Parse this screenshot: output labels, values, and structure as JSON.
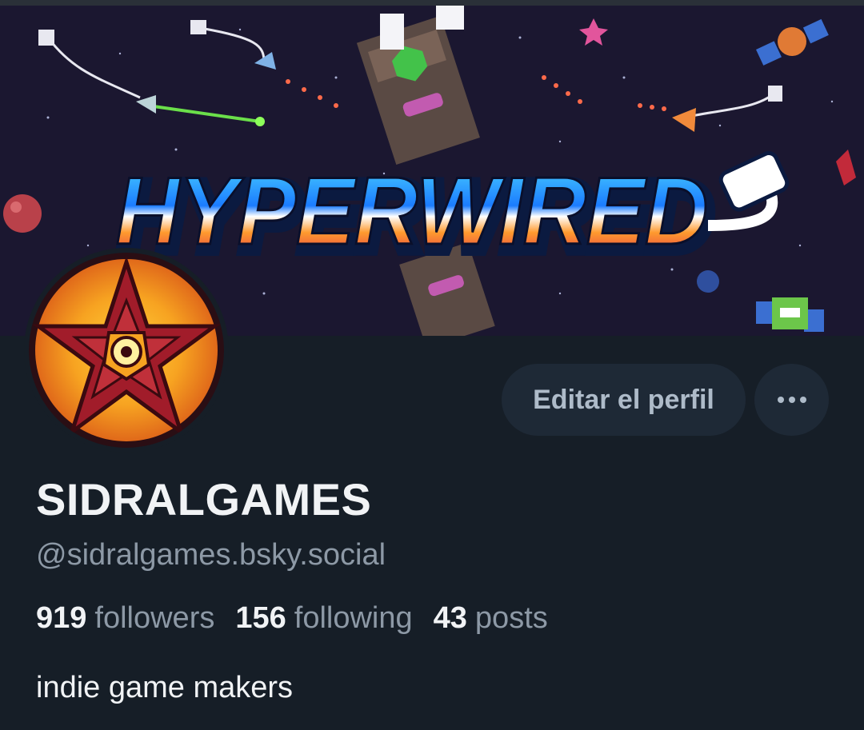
{
  "banner": {
    "title": "HYPERWIRED"
  },
  "profile": {
    "display_name": "SIDRALGAMES",
    "handle": "@sidralgames.bsky.social",
    "bio": "indie game makers"
  },
  "actions": {
    "edit_label": "Editar el perfil",
    "more_label": "•••"
  },
  "stats": [
    {
      "count": "919",
      "label": "followers"
    },
    {
      "count": "156",
      "label": "following"
    },
    {
      "count": "43",
      "label": "posts"
    }
  ],
  "colors": {
    "background": "#161e27",
    "button_bg": "#1e2936",
    "button_text": "#aebbc9",
    "primary_text": "#f1f3f5",
    "secondary_text": "#8d99a6",
    "banner_bg": "#1b1730",
    "avatar_orange": "#f39a1e",
    "avatar_red": "#a11c2a"
  },
  "icons": {
    "more": "ellipsis-icon",
    "avatar": "pentagram-logo"
  }
}
